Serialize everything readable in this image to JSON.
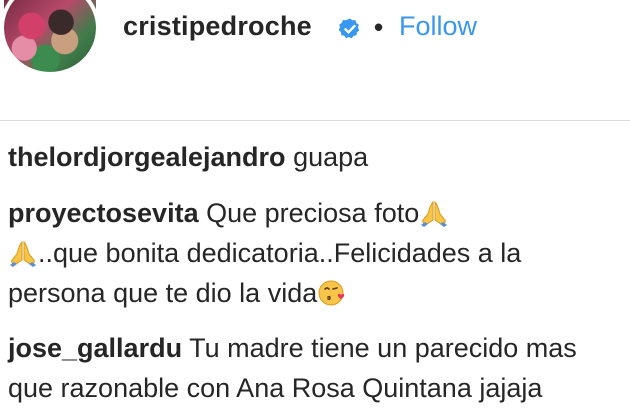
{
  "header": {
    "username": "cristipedroche",
    "separator": "•",
    "follow_label": "Follow"
  },
  "icons": {
    "verified": "verified-badge-icon",
    "pray": "folded-hands-emoji",
    "kiss": "face-blowing-kiss-emoji"
  },
  "colors": {
    "follow": "#3897f0",
    "verified": "#3897f0",
    "text": "#262626",
    "divider": "#dbdbdb"
  },
  "comments": [
    {
      "user": "thelordjorgealejandro",
      "text": "guapa"
    },
    {
      "user": "proyectosevita",
      "text_part1": "Que preciosa foto",
      "text_part2": "..que bonita dedicatoria..Felicidades a la persona que te dio la vida"
    },
    {
      "user": "jose_gallardu",
      "text": "Tu madre tiene un parecido mas que razonable con Ana Rosa Quintana jajaja"
    }
  ]
}
